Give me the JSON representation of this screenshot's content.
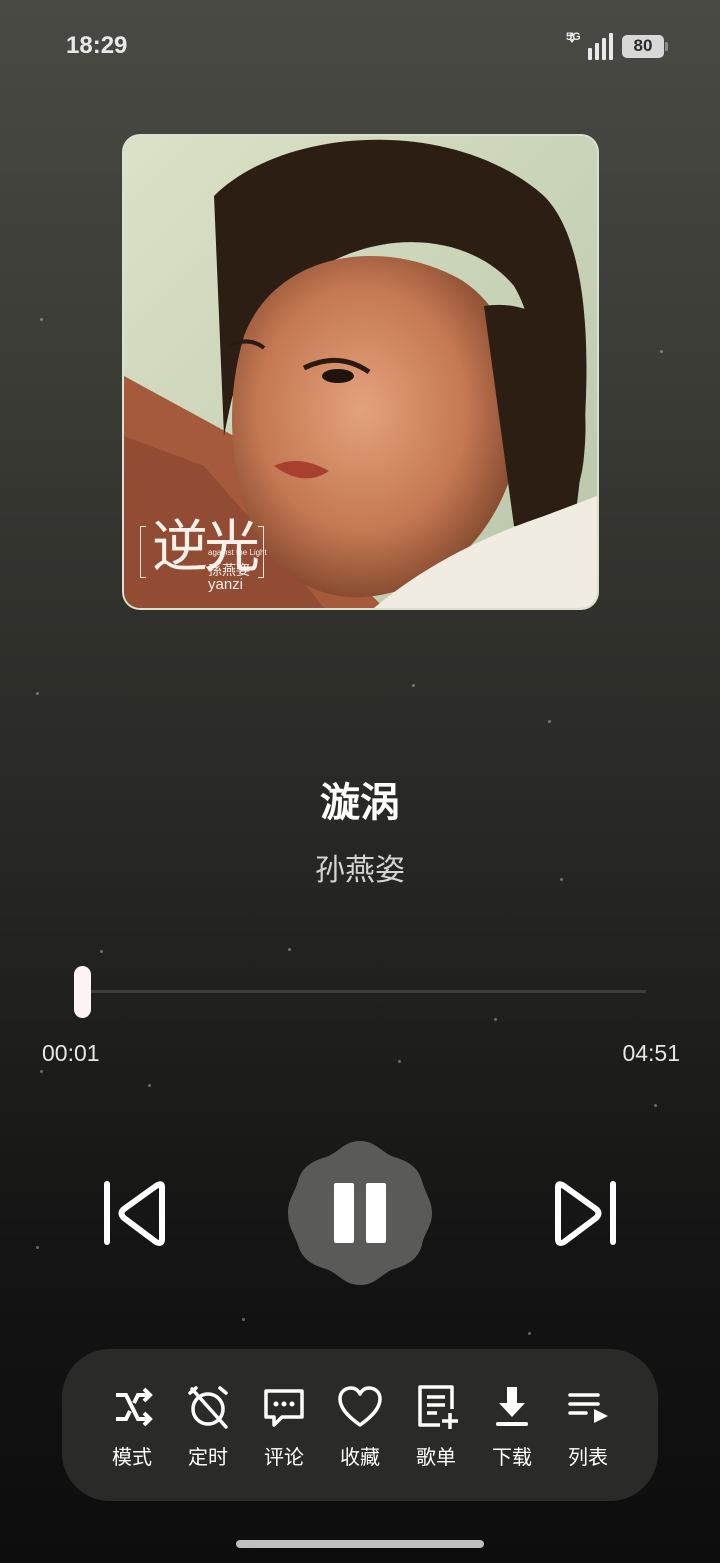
{
  "status_bar": {
    "time": "18:29",
    "network": "5G",
    "battery": "80"
  },
  "album": {
    "title_zh": "逆光",
    "title_en": "against the Light",
    "artist_zh": "孫燕姿",
    "artist_en": "yanzi"
  },
  "song": {
    "title": "漩涡",
    "artist": "孙燕姿"
  },
  "playback": {
    "current_time": "00:01",
    "total_time": "04:51",
    "progress_fraction": 0.0034,
    "state": "playing"
  },
  "colors": {
    "toolbar_bg": "#2a2a29",
    "play_button_bg": "#5a5a58",
    "thumb": "#fff4f4"
  },
  "toolbar": {
    "items": [
      {
        "label": "模式",
        "icon": "shuffle-icon"
      },
      {
        "label": "定时",
        "icon": "alarm-off-icon"
      },
      {
        "label": "评论",
        "icon": "comment-icon"
      },
      {
        "label": "收藏",
        "icon": "heart-icon"
      },
      {
        "label": "歌单",
        "icon": "playlist-add-icon"
      },
      {
        "label": "下载",
        "icon": "download-icon"
      },
      {
        "label": "列表",
        "icon": "queue-icon"
      }
    ]
  }
}
